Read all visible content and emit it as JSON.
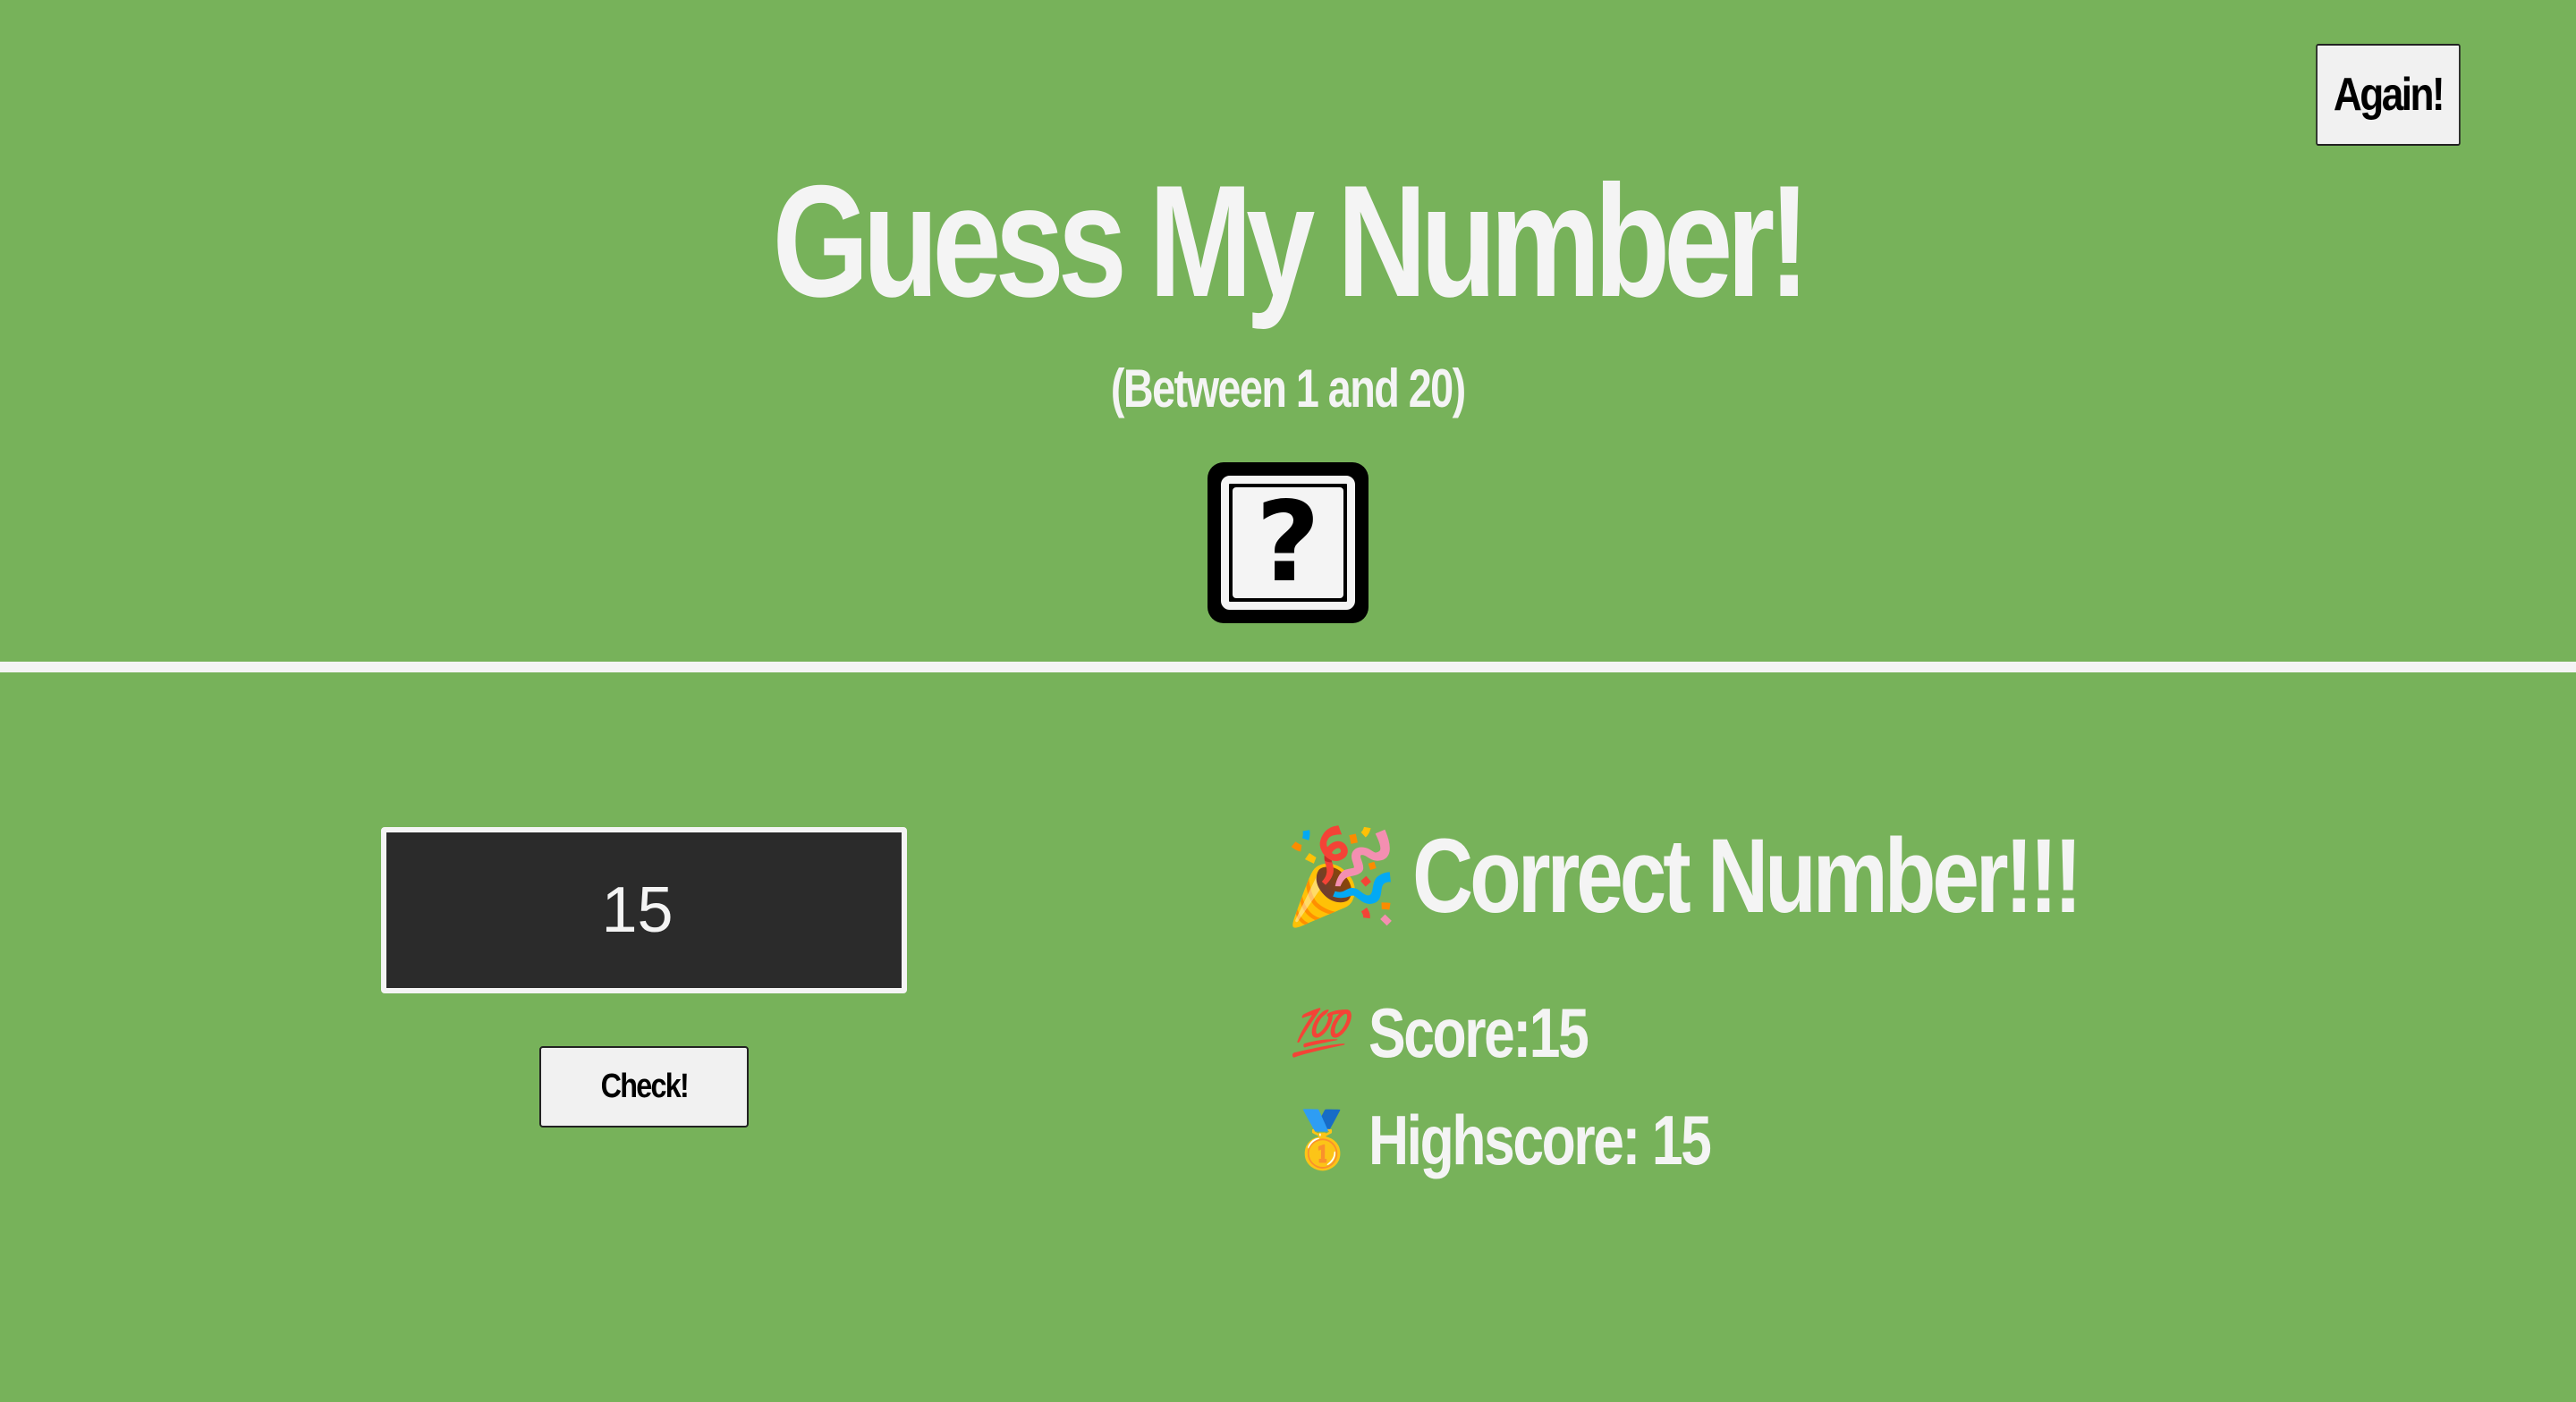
{
  "header": {
    "again_label": "Again!",
    "title": "Guess My Number!",
    "subtitle": "(Between 1 and 20)",
    "secret_symbol": "?"
  },
  "left": {
    "guess_value": "15",
    "check_label": "Check!"
  },
  "right": {
    "message_icon": "party-popper-icon",
    "message_emoji": "🎉",
    "message_text": "Correct Number!!!",
    "score_icon": "hundred-points-icon",
    "score_emoji": "💯",
    "score_text": "Score:15",
    "highscore_icon": "gold-medal-icon",
    "highscore_emoji": "🥇",
    "highscore_text": "Highscore: 15"
  },
  "colors": {
    "background": "#77b25a",
    "text": "#f4f4f4",
    "input_bg": "#2b2b2b",
    "button_bg": "#f1f1f1"
  }
}
